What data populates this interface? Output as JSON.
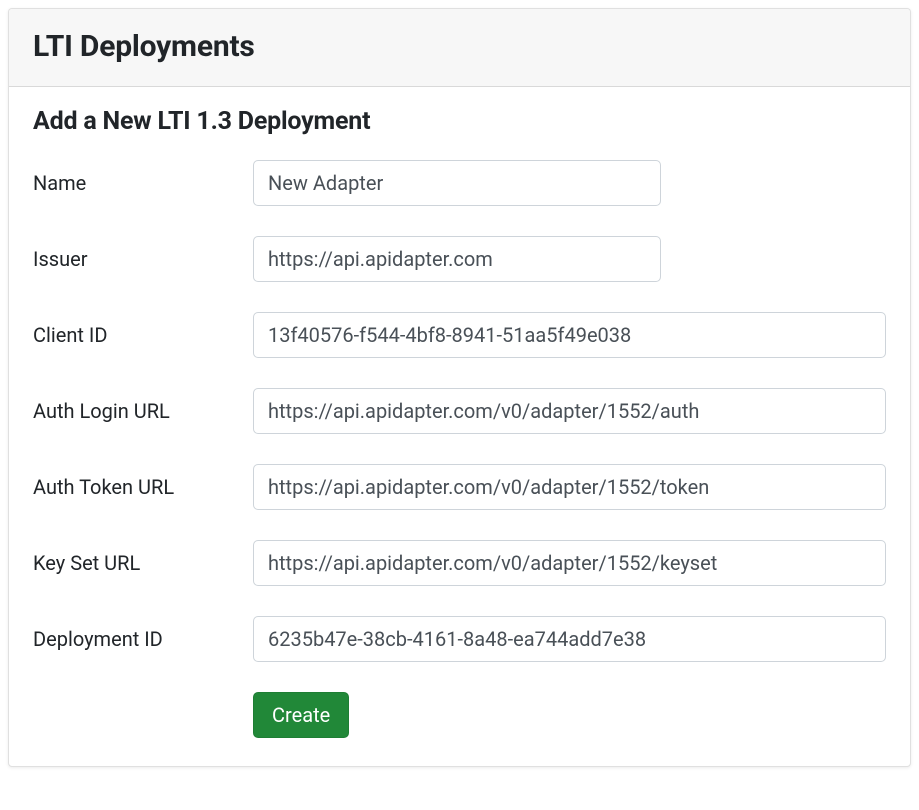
{
  "header": {
    "title": "LTI Deployments"
  },
  "form": {
    "heading": "Add a New LTI 1.3 Deployment",
    "fields": {
      "name": {
        "label": "Name",
        "value": "New Adapter"
      },
      "issuer": {
        "label": "Issuer",
        "value": "https://api.apidapter.com"
      },
      "client_id": {
        "label": "Client ID",
        "value": "13f40576-f544-4bf8-8941-51aa5f49e038"
      },
      "auth_login_url": {
        "label": "Auth Login URL",
        "value": "https://api.apidapter.com/v0/adapter/1552/auth"
      },
      "auth_token_url": {
        "label": "Auth Token URL",
        "value": "https://api.apidapter.com/v0/adapter/1552/token"
      },
      "key_set_url": {
        "label": "Key Set URL",
        "value": "https://api.apidapter.com/v0/adapter/1552/keyset"
      },
      "deployment_id": {
        "label": "Deployment ID",
        "value": "6235b47e-38cb-4161-8a48-ea744add7e38"
      }
    },
    "submit_label": "Create"
  }
}
